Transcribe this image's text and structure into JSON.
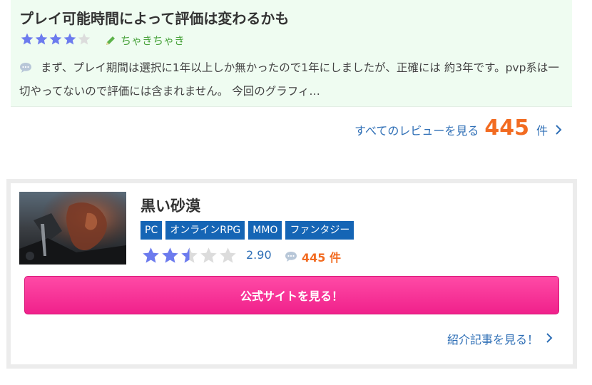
{
  "review": {
    "title": "プレイ可能時間によって評価は変わるかも",
    "rating": 4,
    "rating_max": 5,
    "reviewer": "ちゃきちゃき",
    "body": "まず、プレイ期間は選択に1年以上しか無かったので1年にしましたが、正確には 約3年です。pvp系は一切やってないので評価には含まれません。 今回のグラフィ…"
  },
  "all_reviews": {
    "label": "すべてのレビューを見る",
    "count": "445",
    "unit": "件"
  },
  "game": {
    "title": "黒い砂漠",
    "tags": [
      "PC",
      "オンラインRPG",
      "MMO",
      "ファンタジー"
    ],
    "rating": 2.5,
    "rating_max": 5,
    "score": "2.90",
    "review_count": "445 件",
    "cta_label": "公式サイトを見る！",
    "intro_link": "紹介記事を見る！"
  },
  "colors": {
    "review_bg": "#effcf1",
    "star_filled": "#6c7bee",
    "star_empty": "#dcdcdc",
    "accent_orange": "#f26b21",
    "link_blue": "#2f6fb6",
    "tag_blue": "#1565b5",
    "cta_pink": "#f0218b"
  }
}
